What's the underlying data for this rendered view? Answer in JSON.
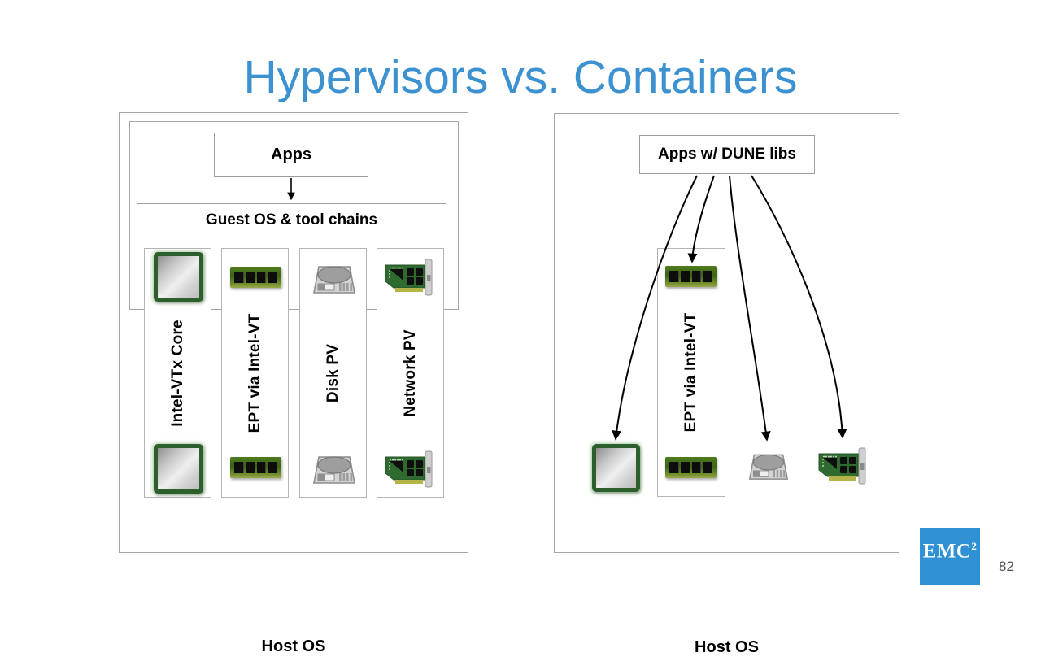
{
  "slide": {
    "title": "Hypervisors vs. Containers",
    "page_number": "82",
    "title_color": "#3c91d0",
    "brand_color": "#2f90d4"
  },
  "brand": {
    "name": "EMC",
    "superscript": "2"
  },
  "left_panel": {
    "name": "Hypervisor stack",
    "apps_box": "Apps",
    "guest_os_box": "Guest OS & tool chains",
    "host_os": "Host OS",
    "columns": [
      {
        "label": "Intel-VTx Core",
        "icon": "cpu-icon"
      },
      {
        "label": "EPT via Intel-VT",
        "icon": "ram-icon"
      },
      {
        "label": "Disk PV",
        "icon": "disk-icon"
      },
      {
        "label": "Network PV",
        "icon": "nic-icon"
      }
    ]
  },
  "right_panel": {
    "name": "Container stack",
    "apps_box": "Apps w/ DUNE libs",
    "host_os": "Host OS",
    "ept_column": {
      "label": "EPT via Intel-VT",
      "icon": "ram-icon"
    },
    "devices": [
      {
        "icon": "cpu-icon"
      },
      {
        "icon": "ram-icon"
      },
      {
        "icon": "disk-icon"
      },
      {
        "icon": "nic-icon"
      }
    ]
  }
}
